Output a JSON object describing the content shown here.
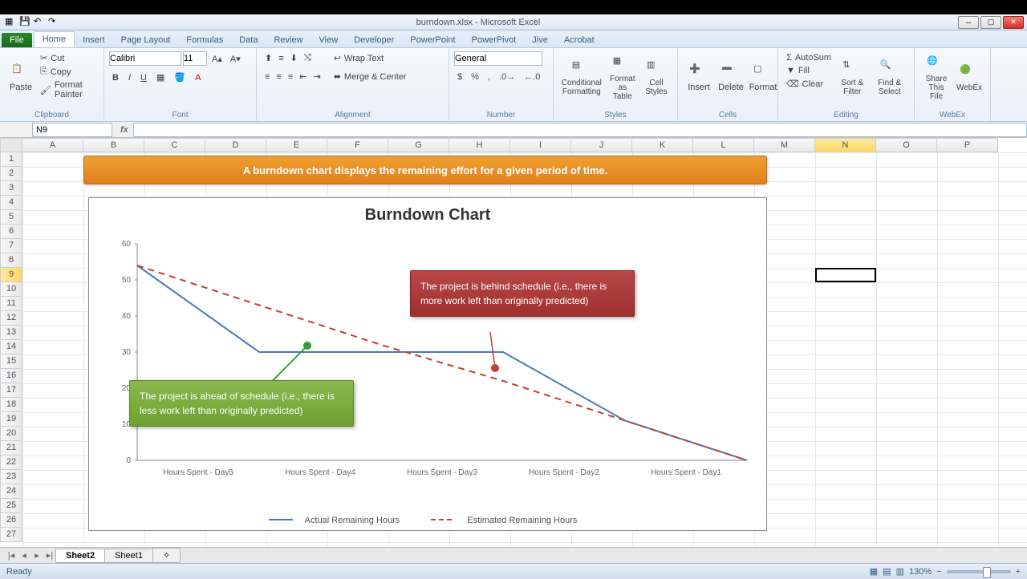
{
  "window": {
    "title": "burndown.xlsx - Microsoft Excel"
  },
  "qat": {
    "save": "💾",
    "undo": "↶",
    "redo": "↷"
  },
  "tabs": {
    "file": "File",
    "home": "Home",
    "insert": "Insert",
    "pagelayout": "Page Layout",
    "formulas": "Formulas",
    "data": "Data",
    "review": "Review",
    "view": "View",
    "developer": "Developer",
    "powerpoint": "PowerPoint",
    "powerpivot": "PowerPivot",
    "jive": "Jive",
    "acrobat": "Acrobat"
  },
  "ribbon": {
    "clipboard": {
      "label": "Clipboard",
      "paste": "Paste",
      "cut": "Cut",
      "copy": "Copy",
      "painter": "Format Painter"
    },
    "font": {
      "label": "Font",
      "family": "Calibri",
      "size": "11"
    },
    "alignment": {
      "label": "Alignment",
      "wrap": "Wrap Text",
      "merge": "Merge & Center"
    },
    "number": {
      "label": "Number",
      "format": "General"
    },
    "styles": {
      "label": "Styles",
      "cond": "Conditional Formatting",
      "table": "Format as Table",
      "cell": "Cell Styles"
    },
    "cells": {
      "label": "Cells",
      "insert": "Insert",
      "delete": "Delete",
      "format": "Format"
    },
    "editing": {
      "label": "Editing",
      "autosum": "AutoSum",
      "fill": "Fill",
      "clear": "Clear",
      "sort": "Sort & Filter",
      "find": "Find & Select"
    },
    "webex": {
      "label": "WebEx",
      "share": "Share This File",
      "meet": "WebEx"
    }
  },
  "namebox": "N9",
  "cols": [
    "A",
    "B",
    "C",
    "D",
    "E",
    "F",
    "G",
    "H",
    "I",
    "J",
    "K",
    "L",
    "M",
    "N",
    "O",
    "P"
  ],
  "active_cell": {
    "col": "N",
    "row": 9
  },
  "banner": "A burndown chart displays the remaining effort for a given period of time.",
  "chart_data": {
    "type": "line",
    "title": "Burndown Chart",
    "categories": [
      "Hours Spent - Day5",
      "Hours Spent - Day4",
      "Hours Spent - Day3",
      "Hours Spent - Day2",
      "Hours Spent - Day1"
    ],
    "series": [
      {
        "name": "Actual Remaining Hours",
        "values": [
          54,
          30,
          30,
          30,
          11,
          0
        ],
        "style": "solid",
        "color": "#4a7ab8"
      },
      {
        "name": "Estimated Remaining Hours",
        "values": [
          54,
          43,
          32,
          22,
          11,
          0
        ],
        "style": "dashed",
        "color": "#c04030"
      }
    ],
    "ylim": [
      0,
      60
    ],
    "yticks": [
      0,
      10,
      20,
      30,
      40,
      50,
      60
    ],
    "annotations": [
      {
        "text": "The project is ahead of schedule (i.e., there is less work left than originally predicted)",
        "color": "green",
        "target_index": 1
      },
      {
        "text": "The project is behind schedule (i.e., there is more work left than originally predicted)",
        "color": "red",
        "target_index": 3
      }
    ]
  },
  "sheets": {
    "active": "Sheet2",
    "tabs": [
      "Sheet2",
      "Sheet1"
    ]
  },
  "status": {
    "ready": "Ready",
    "zoom": "130%"
  }
}
